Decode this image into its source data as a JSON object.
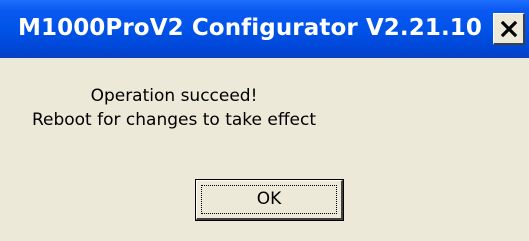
{
  "window": {
    "title": "M1000ProV2 Configurator V2.21.10",
    "close_icon": "close-x-icon"
  },
  "message": {
    "line1": "Operation succeed!",
    "line2": "Reboot for changes to take effect"
  },
  "buttons": {
    "ok_label": "OK"
  },
  "colors": {
    "titlebar": "#0053e8",
    "dialog_background": "#ece9d8",
    "title_text": "#ffffff"
  }
}
